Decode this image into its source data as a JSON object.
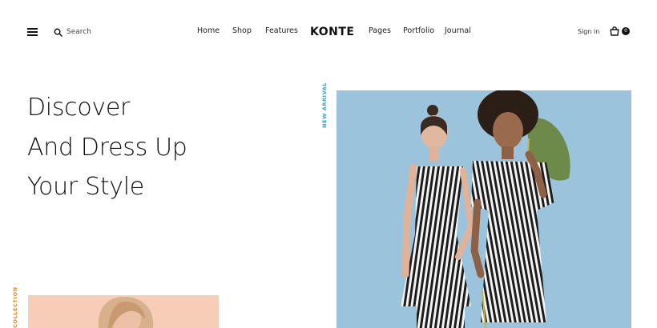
{
  "header": {
    "search_label": "Search",
    "nav_items": [
      "Home",
      "Shop",
      "Features",
      "Pages",
      "Portfolio",
      "Journal"
    ],
    "logo": "KONTE",
    "signin_label": "Sign in",
    "cart_count": "0"
  },
  "hero": {
    "lines": [
      "Discover",
      "And Dress Up",
      "Your Style"
    ],
    "new_arrival_label": "NEW ARRIVAL",
    "collection_label": "COLLECTION"
  },
  "colors": {
    "accent_blue": "#3aa0cf",
    "accent_orange": "#e58a3a",
    "hero_bg": "#9cc3dc",
    "collection_bg": "#f7cdb7"
  },
  "icons": [
    "hamburger-icon",
    "search-icon",
    "bag-icon"
  ]
}
